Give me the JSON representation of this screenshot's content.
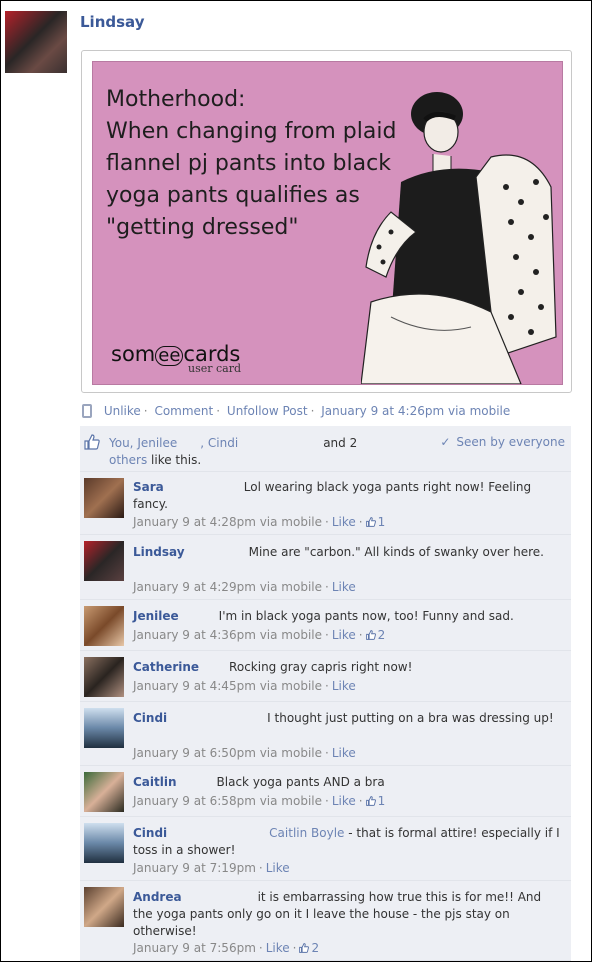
{
  "post": {
    "author": "Lindsay",
    "ecard": {
      "lines": [
        "Motherhood:",
        "When changing from plaid",
        "flannel pj pants into black",
        "yoga pants qualifies as",
        "\"getting dressed\""
      ],
      "logo_left": "som",
      "logo_mid": "ee",
      "logo_right": "cards",
      "logo_sub": "user card",
      "bg_color": "#d592bd"
    },
    "actions": {
      "unlike": "Unlike",
      "comment": "Comment",
      "unfollow": "Unfollow Post",
      "timestamp": "January 9 at 4:26pm via mobile"
    },
    "likes": {
      "line1_a": "You, Jenilee",
      "line1_b": ", Cindi",
      "line1_c": "and 2",
      "others": "others",
      "suffix": " like this.",
      "seen": "Seen by everyone"
    }
  },
  "comments": [
    {
      "name": "Sara",
      "text": "Lol wearing black yoga pants right now! Feeling fancy.",
      "time": "January 9 at 4:28pm via mobile",
      "like": "Like",
      "likes": "1"
    },
    {
      "name": "Lindsay",
      "text": "Mine are \"carbon.\" All kinds of swanky over here.",
      "time": "January 9 at 4:29pm via mobile",
      "like": "Like",
      "likes": ""
    },
    {
      "name": "Jenilee",
      "text": "I'm in black yoga pants now, too! Funny and sad.",
      "time": "January 9 at 4:36pm via mobile",
      "like": "Like",
      "likes": "2"
    },
    {
      "name": "Catherine",
      "text": "Rocking gray capris right now!",
      "time": "January 9 at 4:45pm via mobile",
      "like": "Like",
      "likes": ""
    },
    {
      "name": "Cindi",
      "text": "I thought just putting on a bra was dressing up!",
      "time": "January 9 at 6:50pm via mobile",
      "like": "Like",
      "likes": ""
    },
    {
      "name": "Caitlin",
      "text": "Black yoga pants AND a bra",
      "time": "January 9 at 6:58pm via mobile",
      "like": "Like",
      "likes": "1"
    },
    {
      "name": "Cindi",
      "mention": "Caitlin Boyle",
      "text": "- that is formal attire! especially if I toss in a shower!",
      "time": "January 9 at 7:19pm",
      "like": "Like",
      "likes": ""
    },
    {
      "name": "Andrea",
      "text": "it is embarrassing how true this is for me!! And the yoga pants only go on it I leave the house - the pjs stay on otherwise!",
      "time": "January 9 at 7:56pm",
      "like": "Like",
      "likes": "2"
    }
  ],
  "colors": {
    "link": "#3b5998",
    "muted_link": "#6d84b4",
    "comment_bg": "#edeff4"
  }
}
